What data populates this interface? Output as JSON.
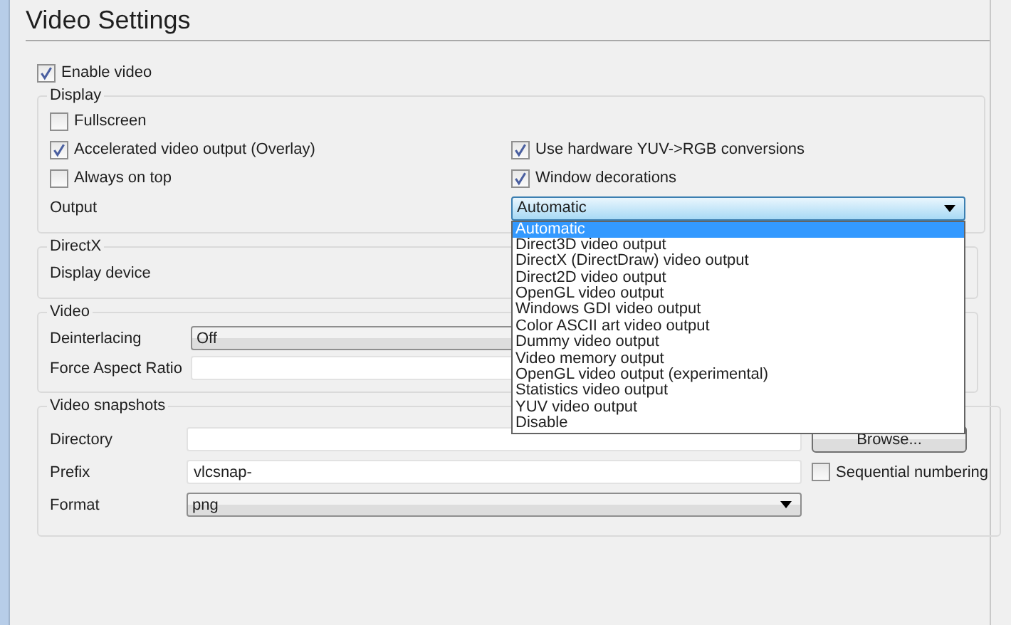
{
  "title": "Video Settings",
  "enable_video": {
    "label": "Enable video",
    "checked": true
  },
  "display": {
    "legend": "Display",
    "rows": [
      {
        "items": [
          {
            "label": "Fullscreen",
            "checked": false
          }
        ]
      },
      {
        "items": [
          {
            "label": "Accelerated video output (Overlay)",
            "checked": true
          },
          {
            "label": "Use hardware YUV->RGB conversions",
            "checked": true
          }
        ]
      },
      {
        "items": [
          {
            "label": "Always on top",
            "checked": false
          },
          {
            "label": "Window decorations",
            "checked": true
          }
        ]
      }
    ],
    "output": {
      "label": "Output",
      "value": "Automatic",
      "expanded": true,
      "options": [
        {
          "label": "Automatic",
          "selected": true
        },
        {
          "label": "Direct3D video output",
          "selected": false
        },
        {
          "label": "DirectX (DirectDraw) video output",
          "selected": false
        },
        {
          "label": "Direct2D video output",
          "selected": false
        },
        {
          "label": "OpenGL video output",
          "selected": false
        },
        {
          "label": "Windows GDI video output",
          "selected": false
        },
        {
          "label": "Color ASCII art video output",
          "selected": false
        },
        {
          "label": "Dummy video output",
          "selected": false
        },
        {
          "label": "Video memory output",
          "selected": false
        },
        {
          "label": "OpenGL video output (experimental)",
          "selected": false
        },
        {
          "label": "Statistics video output",
          "selected": false
        },
        {
          "label": "YUV video output",
          "selected": false
        },
        {
          "label": "Disable",
          "selected": false
        }
      ]
    }
  },
  "directx": {
    "legend": "DirectX",
    "display_device_label": "Display device"
  },
  "video": {
    "legend": "Video",
    "deinterlacing": {
      "label": "Deinterlacing",
      "value": "Off"
    },
    "aspect_ratio_label": "Force Aspect Ratio"
  },
  "snapshots": {
    "legend": "Video snapshots",
    "directory_label": "Directory",
    "browse_button": "Browse...",
    "prefix": {
      "label": "Prefix",
      "value": "vlcsnap-"
    },
    "sequential": {
      "label": "Sequential numbering",
      "checked": false
    },
    "format": {
      "label": "Format",
      "value": "png"
    }
  }
}
